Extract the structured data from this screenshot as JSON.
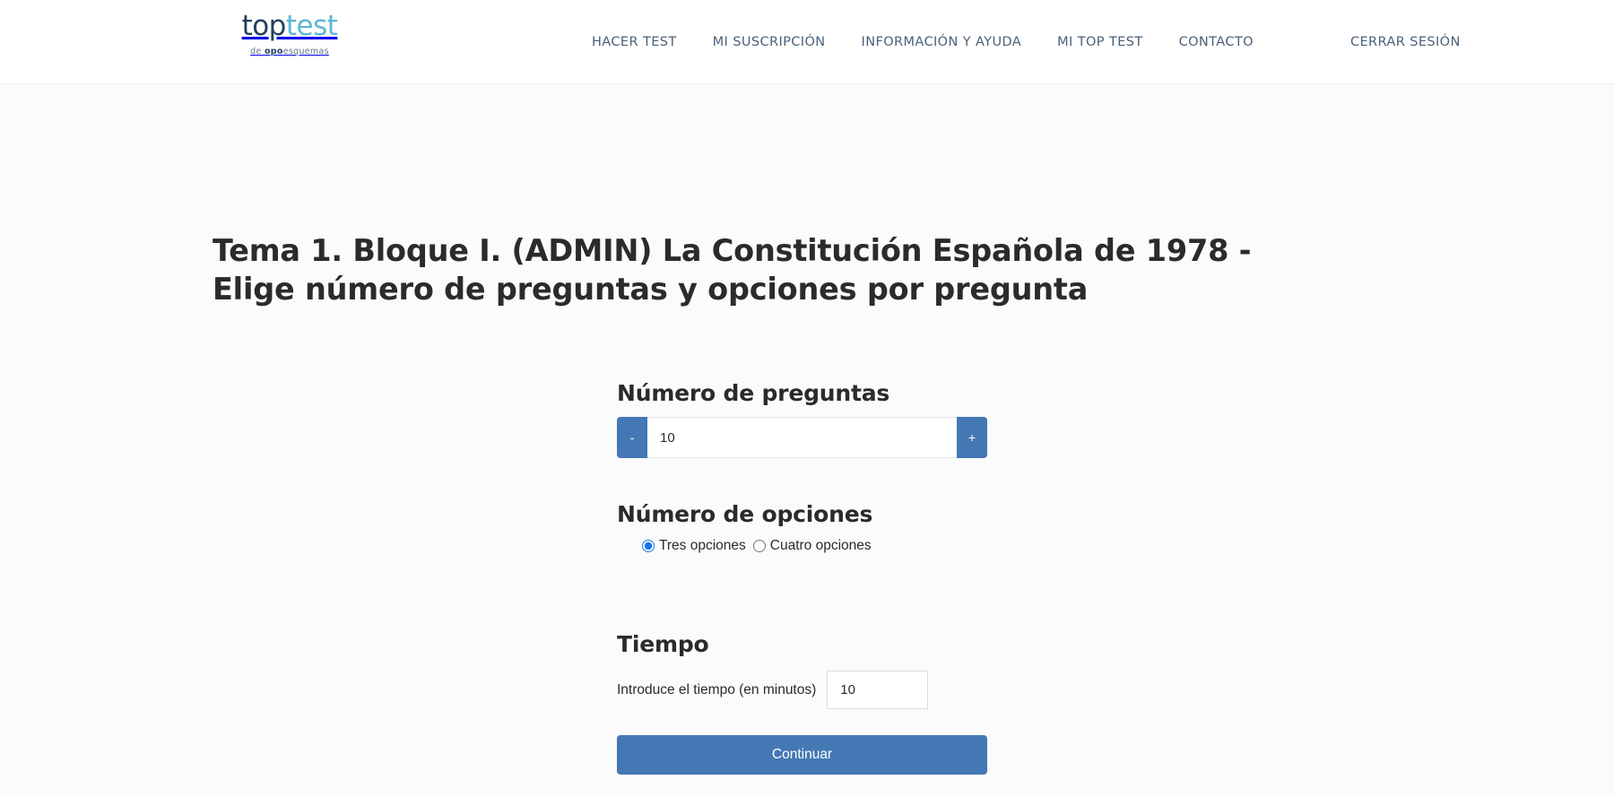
{
  "header": {
    "brand": {
      "name_part1": "top",
      "name_part2": "test",
      "tagline_prefix": "de ",
      "tagline_bold": "opo",
      "tagline_suffix": "esquemas"
    },
    "nav": [
      {
        "label": "HACER TEST",
        "name": "nav-hacer-test"
      },
      {
        "label": "MI SUSCRIPCIÓN",
        "name": "nav-mi-suscripcion"
      },
      {
        "label": "INFORMACIÓN Y AYUDA",
        "name": "nav-informacion-y-ayuda"
      },
      {
        "label": "MI TOP TEST",
        "name": "nav-mi-top-test"
      },
      {
        "label": "CONTACTO",
        "name": "nav-contacto"
      }
    ],
    "logout_label": "CERRAR SESIÓN"
  },
  "main": {
    "title": "Tema 1. Bloque I. (ADMIN) La Constitución Española de 1978 - Elige número de preguntas y opciones por pregunta",
    "questions": {
      "label": "Número de preguntas",
      "decrement_label": "-",
      "increment_label": "+",
      "value": "10"
    },
    "options": {
      "label": "Número de opciones",
      "choices": [
        {
          "label": "Tres opciones",
          "value": "3",
          "selected": true
        },
        {
          "label": "Cuatro opciones",
          "value": "4",
          "selected": false
        }
      ]
    },
    "time": {
      "label": "Tiempo",
      "field_label": "Introduce el tiempo (en minutos)",
      "value": "10"
    },
    "submit_label": "Continuar"
  },
  "colors": {
    "accent_blue": "#4478b4",
    "brand_dark": "#21415e",
    "brand_light": "#5bb7d6",
    "nav_text": "#4a6179",
    "radio_selected": "#1a73e8",
    "page_background": "#fbfbfc"
  }
}
